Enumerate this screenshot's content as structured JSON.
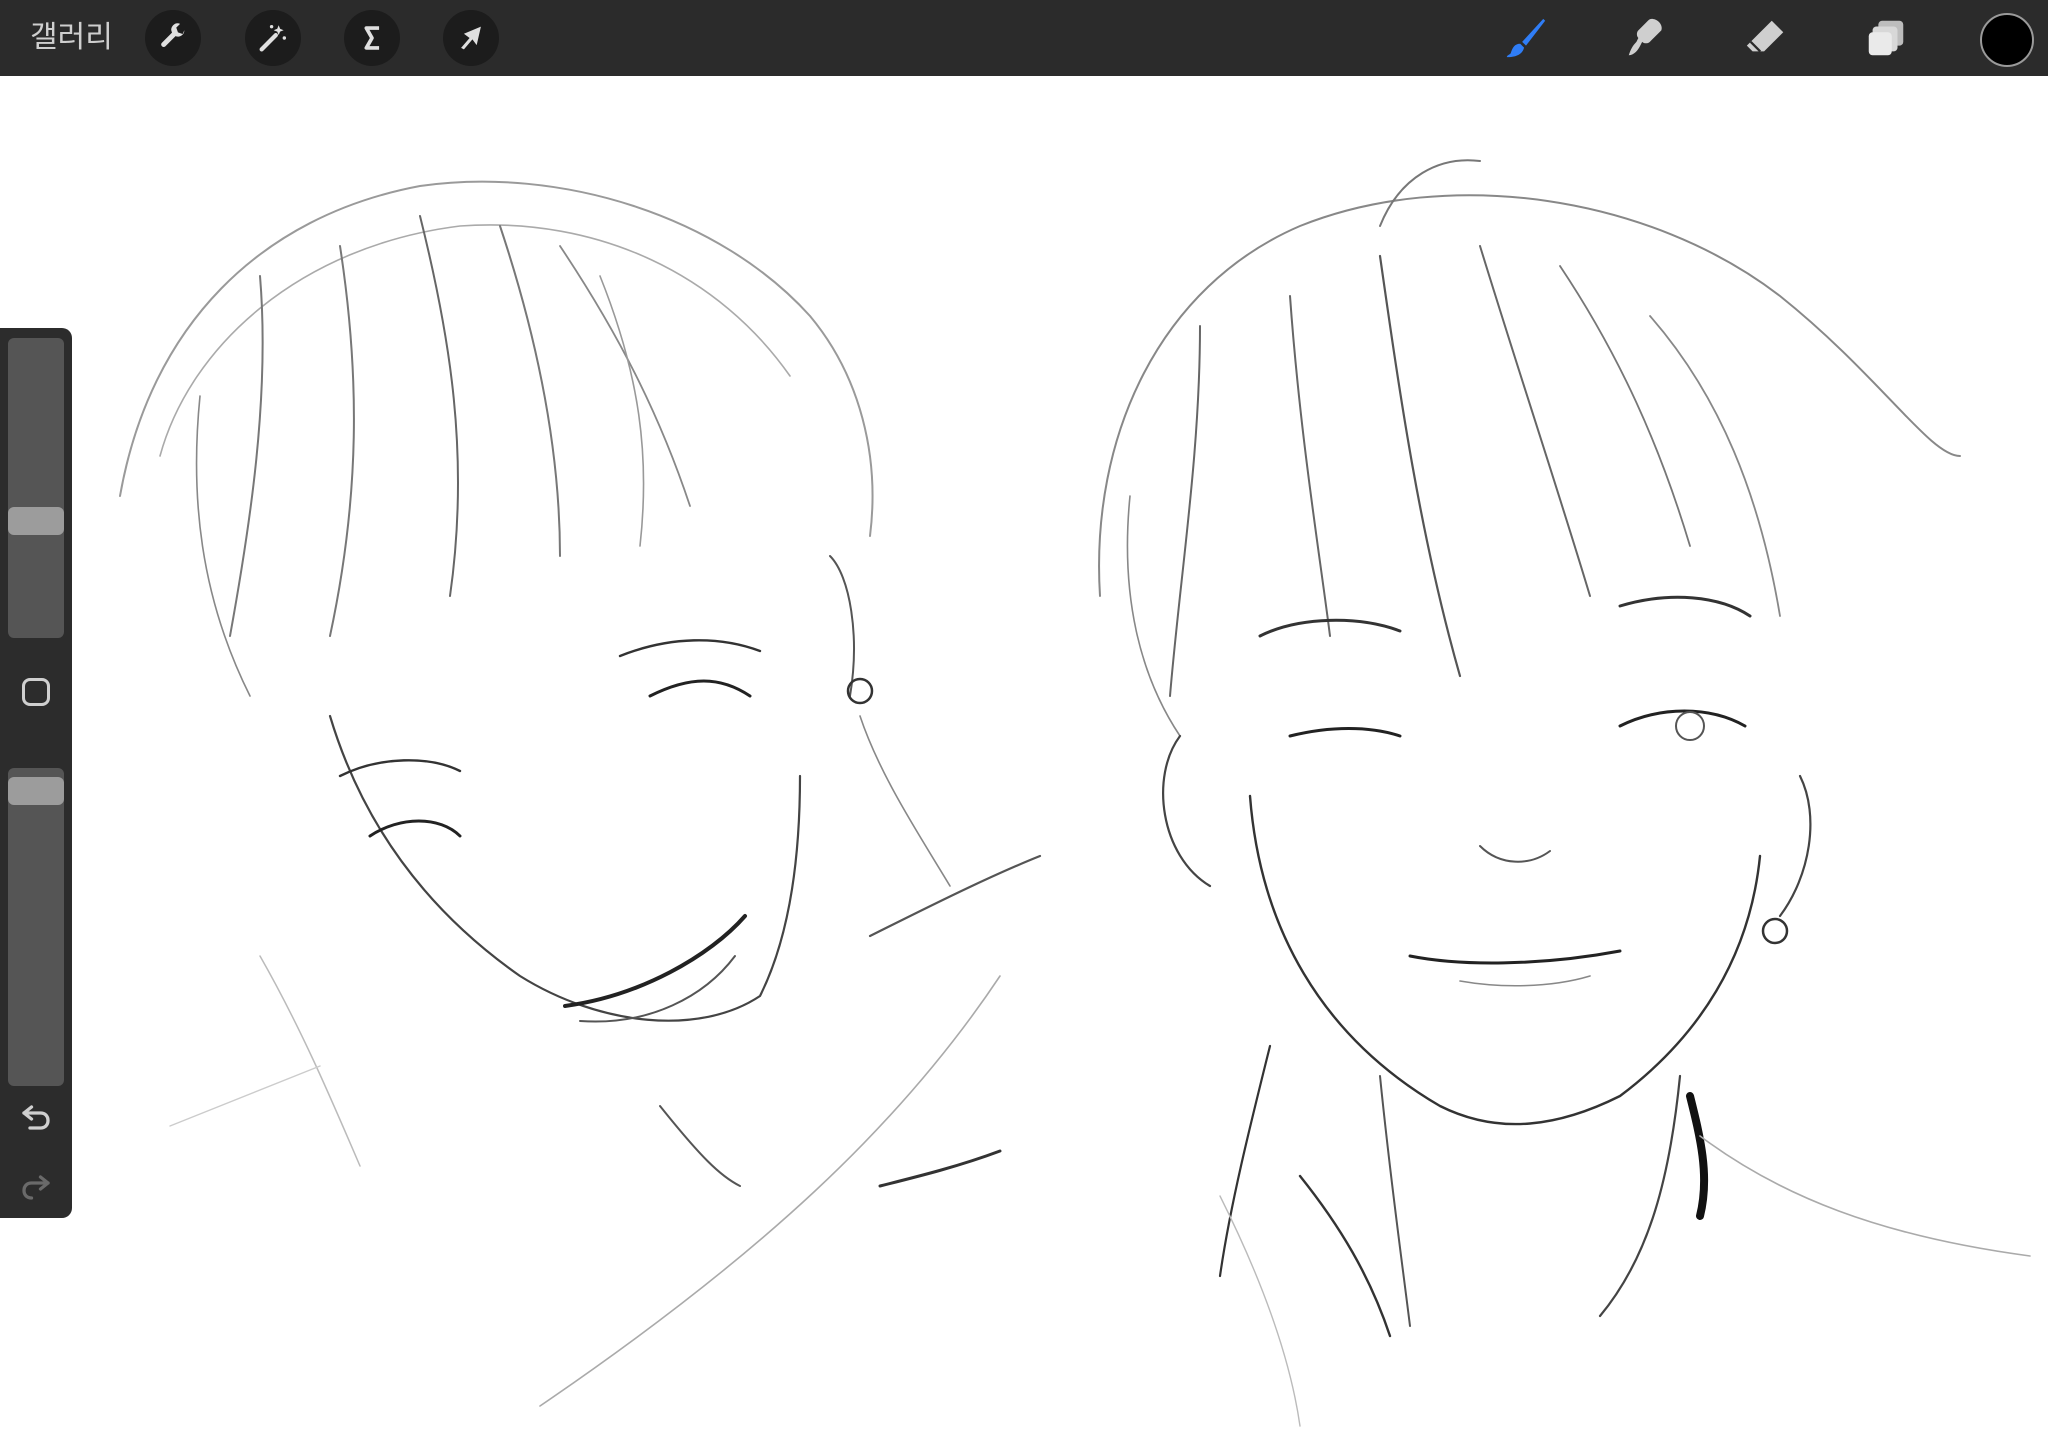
{
  "toolbar": {
    "gallery_label": "갤러리",
    "left_tools": [
      {
        "name": "adjustments",
        "icon": "wrench-icon"
      },
      {
        "name": "magic",
        "icon": "magic-wand-icon"
      },
      {
        "name": "selection",
        "icon": "selection-s-icon"
      },
      {
        "name": "transform",
        "icon": "arrow-cursor-icon"
      }
    ],
    "right_tools": [
      {
        "name": "brush",
        "icon": "brush-icon",
        "active": true
      },
      {
        "name": "smudge",
        "icon": "smudge-icon"
      },
      {
        "name": "eraser",
        "icon": "eraser-icon"
      },
      {
        "name": "layers",
        "icon": "layers-icon"
      }
    ],
    "current_color": "#000000",
    "accent_color": "#2f7df6"
  },
  "sidebar": {
    "brush_size_level": 0.38,
    "opacity_level": 0.97,
    "undo_icon": "undo-icon",
    "redo_icon": "redo-icon",
    "modify_icon": "square-icon"
  }
}
